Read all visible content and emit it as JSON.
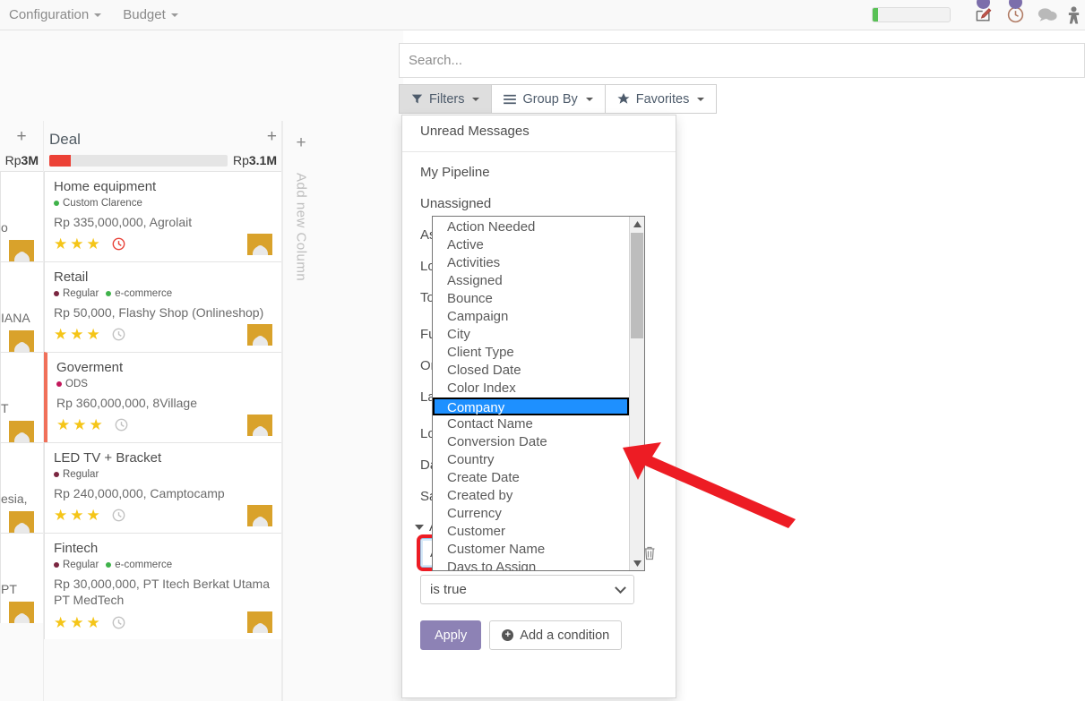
{
  "topbar": {
    "menus": [
      {
        "label": "Configuration",
        "icon": "chevron-down-icon"
      },
      {
        "label": "Budget",
        "icon": "chevron-down-icon"
      }
    ],
    "progress": {
      "percent": 7,
      "fill_color": "#59c156",
      "track_color": "#f2f2f2"
    },
    "icons": [
      {
        "name": "compose-icon",
        "badge": true
      },
      {
        "name": "clock-icon",
        "badge": true
      },
      {
        "name": "chat-bubble-icon",
        "badge": false
      },
      {
        "name": "user-menu-icon",
        "badge": false
      }
    ]
  },
  "search": {
    "placeholder": "Search...",
    "value": ""
  },
  "controls": {
    "filters": {
      "label": "Filters",
      "icon": "funnel-icon",
      "active": true
    },
    "group_by": {
      "label": "Group By",
      "icon": "list-icon",
      "active": false
    },
    "favorites": {
      "label": "Favorites",
      "icon": "star-icon",
      "active": false
    }
  },
  "filters_dropdown": {
    "top_items": [
      "Unread Messages"
    ],
    "preset_items": [
      "My Pipeline",
      "Unassigned"
    ],
    "hidden_items": [
      "Assigned to Me",
      "Lost",
      "To Do",
      "Future",
      "Ongoing",
      "Last 30 Days",
      "Lost Reason",
      "Date",
      "Salesperson"
    ],
    "add_custom_filter_label": "Add Custom Filter",
    "condition": {
      "field_value": "Action Needed",
      "operator_value": "is true",
      "delete_icon": "trash-icon",
      "field_highlighted": true
    },
    "apply_label": "Apply",
    "add_condition_label": "Add a condition"
  },
  "field_list": {
    "selected": "Company",
    "options": [
      "Action Needed",
      "Active",
      "Activities",
      "Assigned",
      "Bounce",
      "Campaign",
      "City",
      "Client Type",
      "Closed Date",
      "Color Index",
      "Company",
      "Contact Name",
      "Conversion Date",
      "Country",
      "Create Date",
      "Created by",
      "Currency",
      "Customer",
      "Customer Name",
      "Days to Assign"
    ],
    "scroll_up_icon": "triangle-up-icon",
    "scroll_down_icon": "triangle-down-icon"
  },
  "annotation": {
    "arrow_color": "#ed1c24",
    "highlight_color": "#ed1c24"
  },
  "kanban": {
    "add_new_column": {
      "label": "Add new Column",
      "icon": "plus-icon"
    },
    "columns": [
      {
        "name": "partial-left-column",
        "title": "",
        "amount": "Rp3M",
        "amount_prefix": "Rp",
        "amount_value": "3M",
        "meter_percent": 0,
        "plus_icon": "plus-icon",
        "cards": [
          {
            "title": "",
            "tags": [],
            "amount_partial": "o",
            "stars": 0,
            "avatar": true
          },
          {
            "title": "",
            "tags": [],
            "amount_partial": "IANA",
            "stars": 0,
            "avatar": true
          },
          {
            "title": "",
            "tags": [],
            "amount_partial": "T",
            "stars": 0,
            "avatar": true
          },
          {
            "title": "",
            "tags": [],
            "amount_partial": "esia,",
            "stars": 0,
            "avatar": true
          },
          {
            "title": "",
            "tags": [],
            "amount_partial": "PT",
            "stars": 0,
            "avatar": true
          }
        ]
      },
      {
        "name": "deal-column",
        "title": "Deal",
        "amount": "Rp3.1M",
        "amount_prefix": "Rp",
        "amount_value": "3.1M",
        "meter_percent": 12,
        "meter_color": "#ec4136",
        "plus_icon": "plus-icon",
        "cards": [
          {
            "title": "Home equipment",
            "tags": [
              {
                "label": "Custom Clarence",
                "color": "#3fb24a"
              }
            ],
            "amount": "Rp 335,000,000, Agrolait",
            "stars": 3,
            "clock": "red",
            "flag": false,
            "avatar": true
          },
          {
            "title": "Retail",
            "tags": [
              {
                "label": "Regular",
                "color": "#7a2640"
              },
              {
                "label": "e-commerce",
                "color": "#3fb24a"
              }
            ],
            "amount": "Rp 50,000, Flashy Shop (Onlineshop)",
            "stars": 3,
            "clock": "grey",
            "flag": false,
            "avatar": true
          },
          {
            "title": "Goverment",
            "tags": [
              {
                "label": "ODS",
                "color": "#c2185b"
              }
            ],
            "amount": "Rp 360,000,000, 8Village",
            "stars": 3,
            "clock": "grey",
            "flag": true,
            "avatar": true
          },
          {
            "title": "LED TV + Bracket",
            "tags": [
              {
                "label": "Regular",
                "color": "#7a2640"
              }
            ],
            "amount": "Rp 240,000,000, Camptocamp",
            "stars": 3,
            "clock": "grey",
            "flag": false,
            "avatar": true
          },
          {
            "title": "Fintech",
            "tags": [
              {
                "label": "Regular",
                "color": "#7a2640"
              },
              {
                "label": "e-commerce",
                "color": "#3fb24a"
              }
            ],
            "amount": "Rp 30,000,000, PT Itech Berkat Utama PT MedTech",
            "stars": 3,
            "clock": "grey",
            "flag": false,
            "avatar": true
          }
        ]
      }
    ]
  }
}
